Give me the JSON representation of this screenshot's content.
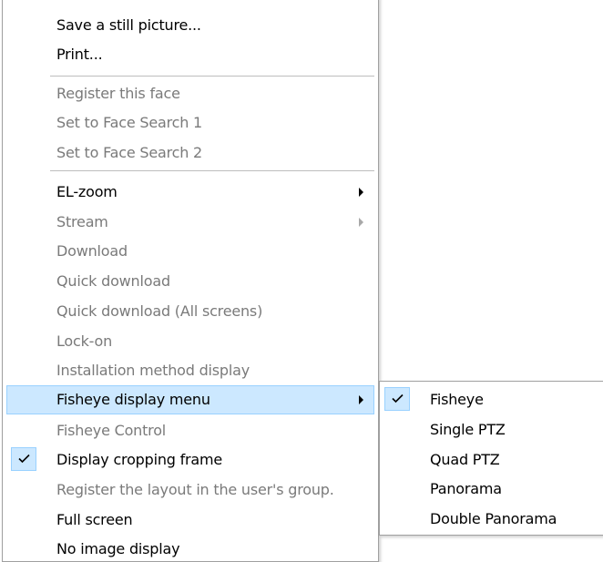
{
  "menu": {
    "groups": [
      {
        "items": [
          {
            "label": "Save a still picture...",
            "enabled": true
          },
          {
            "label": "Print...",
            "enabled": true
          }
        ]
      },
      {
        "items": [
          {
            "label": "Register this face",
            "enabled": false
          },
          {
            "label": "Set to Face Search 1",
            "enabled": false
          },
          {
            "label": "Set to Face Search 2",
            "enabled": false
          }
        ]
      },
      {
        "items": [
          {
            "label": "EL-zoom",
            "enabled": true,
            "submenu": true
          },
          {
            "label": "Stream",
            "enabled": false,
            "submenu": true
          },
          {
            "label": "Download",
            "enabled": false
          },
          {
            "label": "Quick download",
            "enabled": false
          },
          {
            "label": "Quick download (All screens)",
            "enabled": false
          },
          {
            "label": "Lock-on",
            "enabled": false
          },
          {
            "label": "Installation method display",
            "enabled": false
          },
          {
            "label": "Fisheye display menu",
            "enabled": true,
            "submenu": true,
            "highlighted": true
          },
          {
            "label": "Fisheye Control",
            "enabled": false
          },
          {
            "label": "Display cropping frame",
            "enabled": true,
            "checked": true
          },
          {
            "label": "Register the layout in the user's group.",
            "enabled": false
          },
          {
            "label": "Full screen",
            "enabled": true
          },
          {
            "label": "No image display",
            "enabled": true
          }
        ]
      }
    ]
  },
  "submenu": {
    "items": [
      {
        "label": "Fisheye",
        "checked": true
      },
      {
        "label": "Single PTZ",
        "checked": false
      },
      {
        "label": "Quad PTZ",
        "checked": false
      },
      {
        "label": "Panorama",
        "checked": false
      },
      {
        "label": "Double Panorama",
        "checked": false
      }
    ]
  },
  "colors": {
    "highlight_bg": "#cce8ff",
    "highlight_border": "#99d1ff",
    "disabled_text": "#7a7a7a",
    "separator": "#bdbdbd"
  }
}
